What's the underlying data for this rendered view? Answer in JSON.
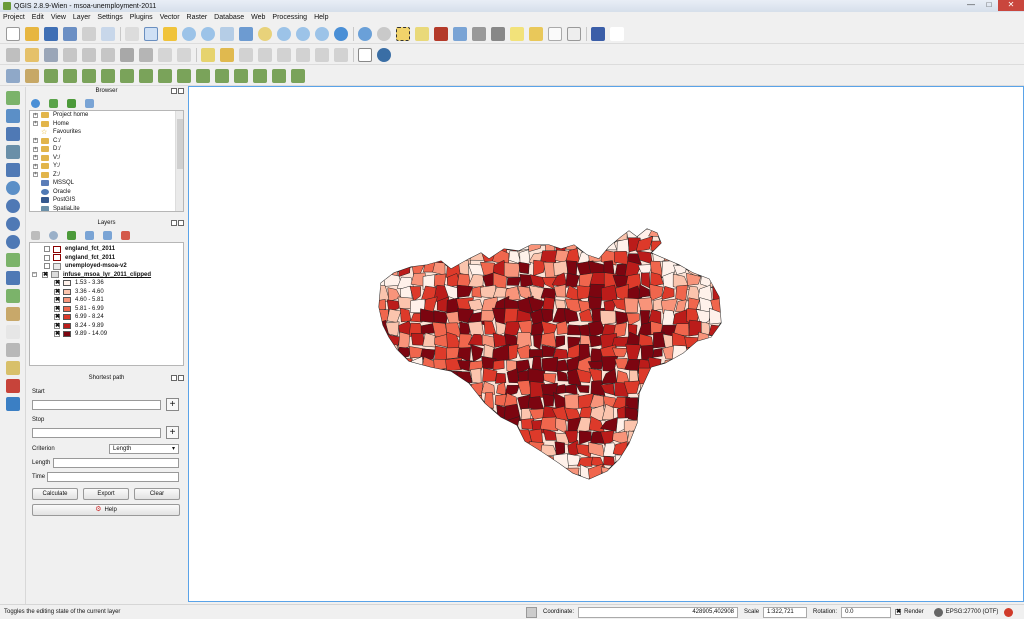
{
  "window": {
    "title": "QGIS 2.8.9-Wien - msoa-unemployment-2011",
    "min_glyph": "—",
    "max_glyph": "□",
    "close_glyph": "✕"
  },
  "menu": [
    "Project",
    "Edit",
    "View",
    "Layer",
    "Settings",
    "Plugins",
    "Vector",
    "Raster",
    "Database",
    "Web",
    "Processing",
    "Help"
  ],
  "browser": {
    "title": "Browser",
    "items": [
      {
        "label": "Project home",
        "kind": "folder"
      },
      {
        "label": "Home",
        "kind": "folder"
      },
      {
        "label": "Favourites",
        "kind": "star"
      },
      {
        "label": "C:/",
        "kind": "folder"
      },
      {
        "label": "D:/",
        "kind": "folder"
      },
      {
        "label": "V:/",
        "kind": "folder"
      },
      {
        "label": "Y:/",
        "kind": "folder"
      },
      {
        "label": "Z:/",
        "kind": "folder"
      },
      {
        "label": "MSSQL",
        "kind": "db"
      },
      {
        "label": "Oracle",
        "kind": "db"
      },
      {
        "label": "PostGIS",
        "kind": "db"
      },
      {
        "label": "SpatiaLite",
        "kind": "db"
      }
    ]
  },
  "layers": {
    "title": "Layers",
    "items": [
      {
        "label": "england_fct_2011"
      },
      {
        "label": "england_fct_2011"
      },
      {
        "label": "unemployed-msoa-v2"
      },
      {
        "label": "infuse_msoa_lyr_2011_clipped"
      }
    ],
    "legend": [
      {
        "label": "1.53 - 3.36",
        "color": "#fff1ea"
      },
      {
        "label": "3.36 - 4.60",
        "color": "#fbc4ad"
      },
      {
        "label": "4.60 - 5.81",
        "color": "#f8947a"
      },
      {
        "label": "5.81 - 6.99",
        "color": "#f0664d"
      },
      {
        "label": "6.99 - 8.24",
        "color": "#dd3a2a"
      },
      {
        "label": "8.24 - 9.89",
        "color": "#bb1c1a"
      },
      {
        "label": "9.89 - 14.09",
        "color": "#7c0510"
      }
    ],
    "check_glyph": "✖"
  },
  "shortest_path": {
    "title": "Shortest path",
    "start_label": "Start",
    "stop_label": "Stop",
    "criterion_label": "Criterion",
    "criterion_value": "Length",
    "length_label": "Length",
    "time_label": "Time",
    "calculate": "Calculate",
    "export": "Export",
    "clear": "Clear",
    "help": "Help"
  },
  "status": {
    "message": "Toggles the editing state of the current layer",
    "coordinate_label": "Coordinate:",
    "coordinate_value": "428905,402908",
    "scale_label": "Scale",
    "scale_value": "1:322,721",
    "rotation_label": "Rotation:",
    "rotation_value": "0.0",
    "render_label": "Render",
    "crs": "EPSG:27700 (OTF)"
  },
  "colors": {
    "accent": "#5aa3e8",
    "outline": "#222222"
  }
}
